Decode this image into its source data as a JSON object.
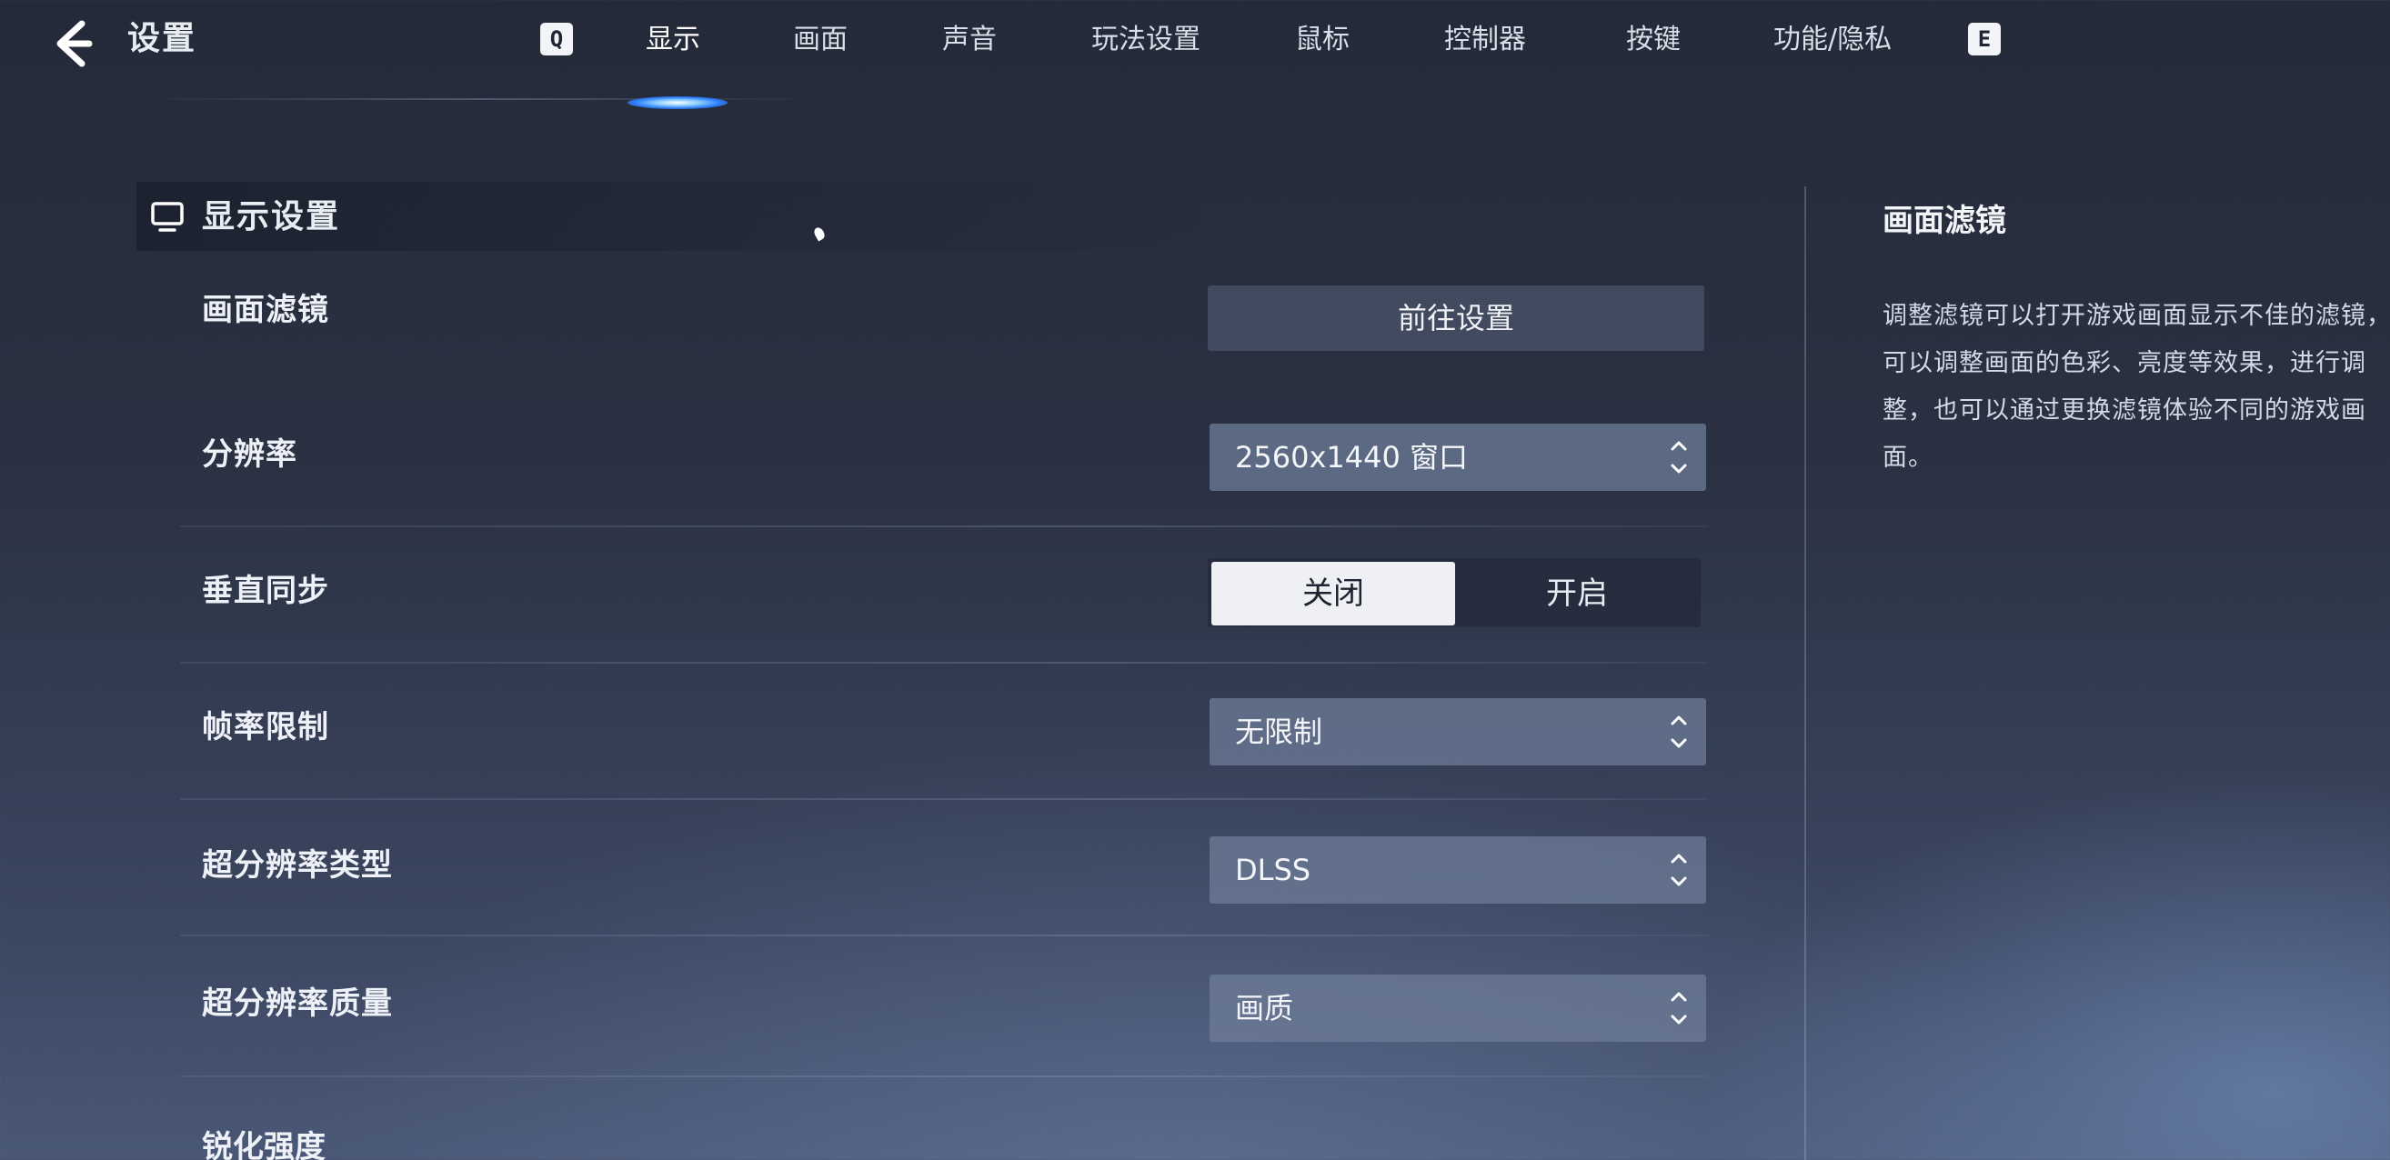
{
  "header": {
    "title": "设置",
    "prev_key": "Q",
    "next_key": "E",
    "tabs": [
      {
        "label": "显示",
        "active": true
      },
      {
        "label": "画面",
        "active": false
      },
      {
        "label": "声音",
        "active": false
      },
      {
        "label": "玩法设置",
        "active": false
      },
      {
        "label": "鼠标",
        "active": false
      },
      {
        "label": "控制器",
        "active": false
      },
      {
        "label": "按键",
        "active": false
      },
      {
        "label": "功能/隐私",
        "active": false
      }
    ]
  },
  "section": {
    "title": "显示设置",
    "icon": "monitor-icon"
  },
  "settings": [
    {
      "label": "画面滤镜",
      "control": "button",
      "value": "前往设置"
    },
    {
      "label": "分辨率",
      "control": "select",
      "value": "2560x1440 窗口"
    },
    {
      "label": "垂直同步",
      "control": "toggle",
      "options": [
        "关闭",
        "开启"
      ],
      "selected": "关闭"
    },
    {
      "label": "帧率限制",
      "control": "select",
      "value": "无限制"
    },
    {
      "label": "超分辨率类型",
      "control": "select",
      "value": "DLSS"
    },
    {
      "label": "超分辨率质量",
      "control": "select",
      "value": "画质"
    },
    {
      "label": "锐化强度"
    }
  ],
  "panel": {
    "title": "画面滤镜",
    "description": "调整滤镜可以打开游戏画面显示不佳的滤镜，可以调整画面的色彩、亮度等效果，进行调整，也可以通过更换滤镜体验不同的游戏画面。"
  },
  "colors": {
    "background": "#2a3142",
    "accent_indicator": "#2f7fff",
    "toggle_selected": "#eef0f4"
  }
}
